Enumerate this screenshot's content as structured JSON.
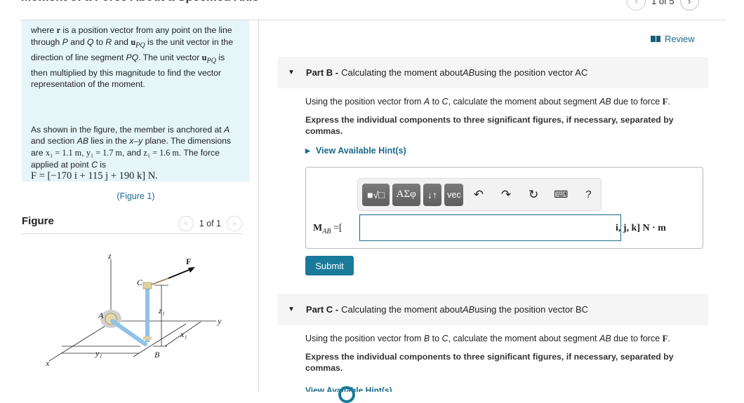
{
  "header": {
    "title": "Moment of a Force About a Specified Axis",
    "pager": {
      "current": 1,
      "total": 5,
      "text": "1 of 5"
    }
  },
  "review": {
    "label": "Review",
    "icon": "book-icon"
  },
  "intro": {
    "para1": {
      "t1": "where ",
      "r": "r",
      "t2": " is a position vector from any point on the line through ",
      "P": "P",
      "t3": " and ",
      "Q": "Q",
      "t4": " to ",
      "R": "R",
      "t5": " and ",
      "u": "u",
      "u_sub": "PQ",
      "t6": " is the unit vector in the direction of line segment ",
      "PQ": "PQ",
      "t7": ". The unit vector ",
      "t8": " is then multiplied by this magnitude to find the vector representation of the moment."
    },
    "para2": {
      "t1": "As shown in the figure, the member is anchored at ",
      "A": "A",
      "t2": " and section ",
      "AB": "AB",
      "t3": " lies in the ",
      "plane": "x–y",
      "t4": " plane. The dimensions are ",
      "x1": "x₁ = 1.1 m",
      "t5": ", ",
      "y1": "y₁ = 1.7 m",
      "t6": ", and ",
      "z1": "z₁ = 1.6 m",
      "t7": ". The force applied at point ",
      "C": "C",
      "t8": " is",
      "force": "F = [−170 i + 115 j + 190 k] N."
    },
    "figure_link": "(Figure 1)"
  },
  "figure_panel": {
    "title": "Figure",
    "pager": {
      "current": 1,
      "total": 1,
      "text": "1 of 1"
    },
    "labels": {
      "z": "z",
      "y": "y",
      "x": "x",
      "A": "A",
      "B": "B",
      "C": "C",
      "F": "F",
      "z1": "z₁",
      "x1": "x₁",
      "y1": "y₁"
    }
  },
  "parts": [
    {
      "id": "B",
      "prefix": "Part B -",
      "title_a": " Calculating the moment about ",
      "title_ab": "AB",
      "title_b": " using the position vector AC",
      "desc_a": "Using the position vector from ",
      "desc_from": "A",
      "desc_b": " to ",
      "desc_to": "C",
      "desc_c": ", calculate the moment about segment ",
      "desc_seg": "AB",
      "desc_d": " due to force ",
      "desc_force": "F",
      "desc_e": ".",
      "instruction": "Express the individual components to three significant figures, if necessary, separated by commas.",
      "hint_label": "View Available Hint(s)",
      "toolbar": {
        "template_btn": "■√□",
        "greek_btn": "ΑΣφ",
        "arrows_btn": "↓↑",
        "vec_btn": "vec",
        "undo": "↶",
        "redo": "↷",
        "reset": "↻",
        "keyboard": "⌨",
        "help": "?"
      },
      "answer_label": "M",
      "answer_sub": "AB",
      "answer_eq": " =[",
      "answer_value": "",
      "answer_units": "i, j, k] N · m",
      "submit_label": "Submit"
    },
    {
      "id": "C",
      "prefix": "Part C -",
      "title_a": " Calculating the moment about ",
      "title_ab": "AB",
      "title_b": " using the position vector BC",
      "desc_a": "Using the position vector from ",
      "desc_from": "B",
      "desc_b": " to ",
      "desc_to": "C",
      "desc_c": ", calculate the moment about segment ",
      "desc_seg": "AB",
      "desc_d": " due to force ",
      "desc_force": "F",
      "desc_e": ".",
      "instruction": "Express the individual components to three significant figures, if necessary, separated by commas.",
      "hint_label": "View Available Hint(s)"
    }
  ]
}
